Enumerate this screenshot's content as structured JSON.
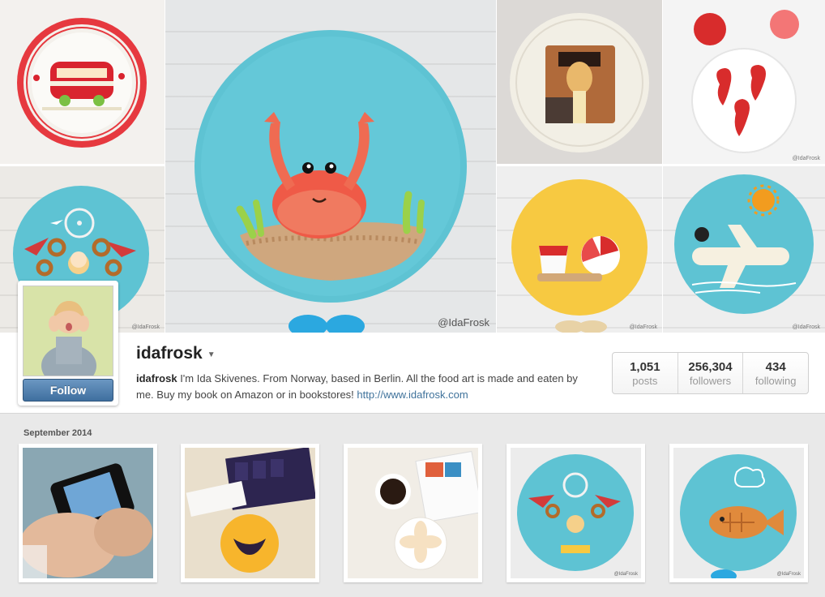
{
  "cover": {
    "watermarks": {
      "large": "@IdaFrosk",
      "small": "@IdaFrosk"
    }
  },
  "profile": {
    "username": "idafrosk",
    "follow_label": "Follow",
    "bio_name": "idafrosk",
    "bio_text": " I'm Ida Skivenes. From Norway, based in Berlin. All the food art is made and eaten by me. Buy my book on Amazon or in bookstores! ",
    "bio_link": "http://www.idafrosk.com"
  },
  "stats": [
    {
      "value": "1,051",
      "label": "posts"
    },
    {
      "value": "256,304",
      "label": "followers"
    },
    {
      "value": "434",
      "label": "following"
    }
  ],
  "feed": {
    "section_label": "September 2014",
    "thumb_watermark": "@IdaFrosk"
  },
  "colors": {
    "follow_button": "#4a7aab",
    "link": "#3f729b",
    "plate_blue": "#5ec3d3",
    "plate_yellow": "#f7c941"
  }
}
